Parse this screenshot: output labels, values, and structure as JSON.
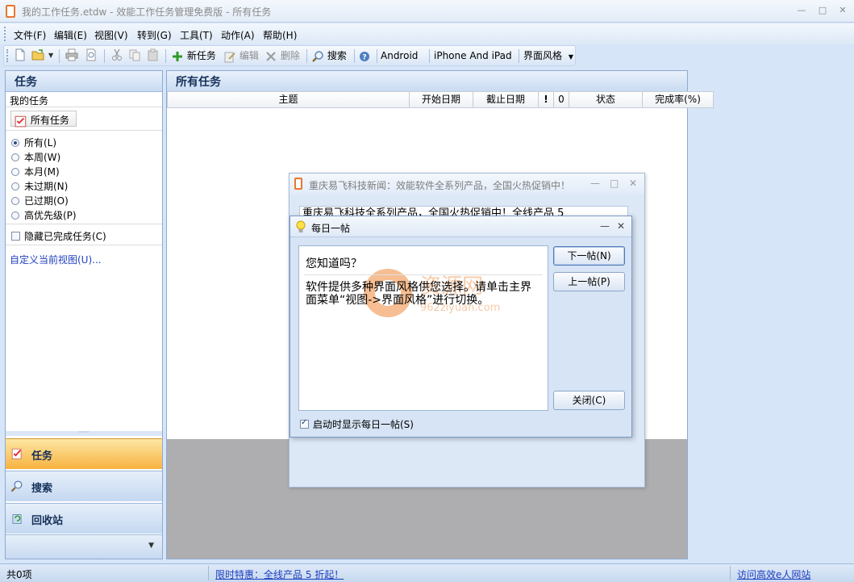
{
  "window": {
    "title": "我的工作任务.etdw - 效能工作任务管理免费版 - 所有任务"
  },
  "menubar": {
    "items": [
      "文件(F)",
      "编辑(E)",
      "视图(V)",
      "转到(G)",
      "工具(T)",
      "动作(A)",
      "帮助(H)"
    ]
  },
  "toolbar": {
    "new_task": "新任务",
    "edit": "编辑",
    "delete": "删除",
    "search": "搜索",
    "android": "Android",
    "iphone": "iPhone And iPad",
    "skin": "界面风格"
  },
  "left_panel": {
    "header": "任务",
    "my_tasks": "我的任务",
    "all_tasks_button": "所有任务",
    "filters": [
      "所有(L)",
      "本周(W)",
      "本月(M)",
      "未过期(N)",
      "已过期(O)",
      "高优先级(P)"
    ],
    "selected_filter": "所有(L)",
    "hide_completed": "隐藏已完成任务(C)",
    "hide_completed_checked": false,
    "customize_link": "自定义当前视图(U)..."
  },
  "nav": {
    "tasks": "任务",
    "search": "搜索",
    "recycle": "回收站"
  },
  "main": {
    "header": "所有任务",
    "columns": [
      "主题",
      "开始日期",
      "截止日期",
      "!",
      "0",
      "状态",
      "完成率(%)"
    ]
  },
  "statusbar": {
    "count": "共0项",
    "promo": "限时特惠：全线产品 5 折起！",
    "site": "访问高效e人网站"
  },
  "news_window": {
    "title": "重庆易飞科技新闻：效能软件全系列产品，全国火热促销中！",
    "ticker": "重庆易飞科技全系列产品，全国火热促销中！全线产品 5"
  },
  "tip_dialog": {
    "title": "每日一帖",
    "heading": "您知道吗？",
    "body": "软件提供多种界面风格供您选择。请单击主界面菜单“视图->界面风格”进行切换。",
    "next": "下一帖(N)",
    "prev": "上一帖(P)",
    "close": "关闭(C)",
    "show_on_startup": "启动时显示每日一帖(S)",
    "show_on_startup_checked": true
  },
  "watermark": {
    "text": "资源网",
    "url": "962ziyuan.com"
  }
}
